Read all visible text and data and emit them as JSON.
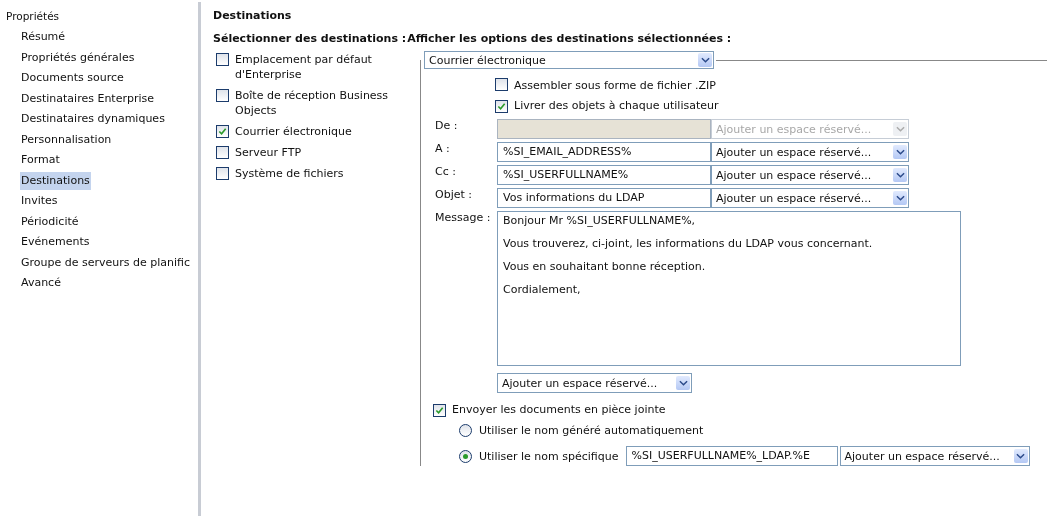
{
  "sidebar": {
    "title": "Propriétés",
    "items": [
      {
        "label": "Résumé",
        "selected": false
      },
      {
        "label": "Propriétés générales",
        "selected": false
      },
      {
        "label": "Documents source",
        "selected": false
      },
      {
        "label": "Destinataires Enterprise",
        "selected": false
      },
      {
        "label": "Destinataires dynamiques",
        "selected": false
      },
      {
        "label": "Personnalisation",
        "selected": false
      },
      {
        "label": "Format",
        "selected": false
      },
      {
        "label": "Destinations",
        "selected": true
      },
      {
        "label": "Invites",
        "selected": false
      },
      {
        "label": "Périodicité",
        "selected": false
      },
      {
        "label": "Evénements",
        "selected": false
      },
      {
        "label": "Groupe de serveurs de planific",
        "selected": false
      },
      {
        "label": "Avancé",
        "selected": false
      }
    ]
  },
  "heading": "Destinations",
  "select_label": "Sélectionner des destinations :",
  "options_label": "Afficher les options des destinations sélectionnées :",
  "destinations": [
    {
      "label": "Emplacement par défaut d'Enterprise",
      "checked": false
    },
    {
      "label": "Boîte de réception Business Objects",
      "checked": false
    },
    {
      "label": "Courrier électronique",
      "checked": true
    },
    {
      "label": "Serveur FTP",
      "checked": false
    },
    {
      "label": "Système de fichiers",
      "checked": false
    }
  ],
  "destination_select": "Courrier électronique",
  "options": [
    {
      "label": "Assembler sous forme de fichier .ZIP",
      "checked": false
    },
    {
      "label": "Livrer des objets à chaque utilisateur",
      "checked": true
    }
  ],
  "fields": [
    {
      "label": "De :",
      "disabled": true,
      "placeholder_select": "Ajouter un espace réservé..."
    },
    {
      "label": "A :",
      "value": "%SI_EMAIL_ADDRESS%",
      "disabled": false,
      "placeholder_select": "Ajouter un espace réservé..."
    },
    {
      "label": "Cc :",
      "value": "%SI_USERFULLNAME%",
      "disabled": false,
      "placeholder_select": "Ajouter un espace réservé..."
    },
    {
      "label": "Objet :",
      "value": "Vos informations du LDAP",
      "disabled": false,
      "placeholder_select": "Ajouter un espace réservé..."
    }
  ],
  "message": {
    "label": "Message :",
    "lines": [
      "Bonjour Mr %SI_USERFULLNAME%,",
      "Vous trouverez, ci-joint, les informations du LDAP vous concernant.",
      "Vous en souhaitant bonne réception.",
      "Cordialement,"
    ],
    "placeholder_select": "Ajouter un espace réservé..."
  },
  "attach": {
    "label": "Envoyer les documents en pièce jointe",
    "checked": true
  },
  "name_options": [
    {
      "label": "Utiliser le nom généré automatiquement",
      "selected": false
    },
    {
      "label": "Utiliser le nom spécifique",
      "selected": true,
      "value": "%SI_USERFULLNAME%_LDAP.%E",
      "placeholder_select": "Ajouter un espace réservé..."
    }
  ]
}
